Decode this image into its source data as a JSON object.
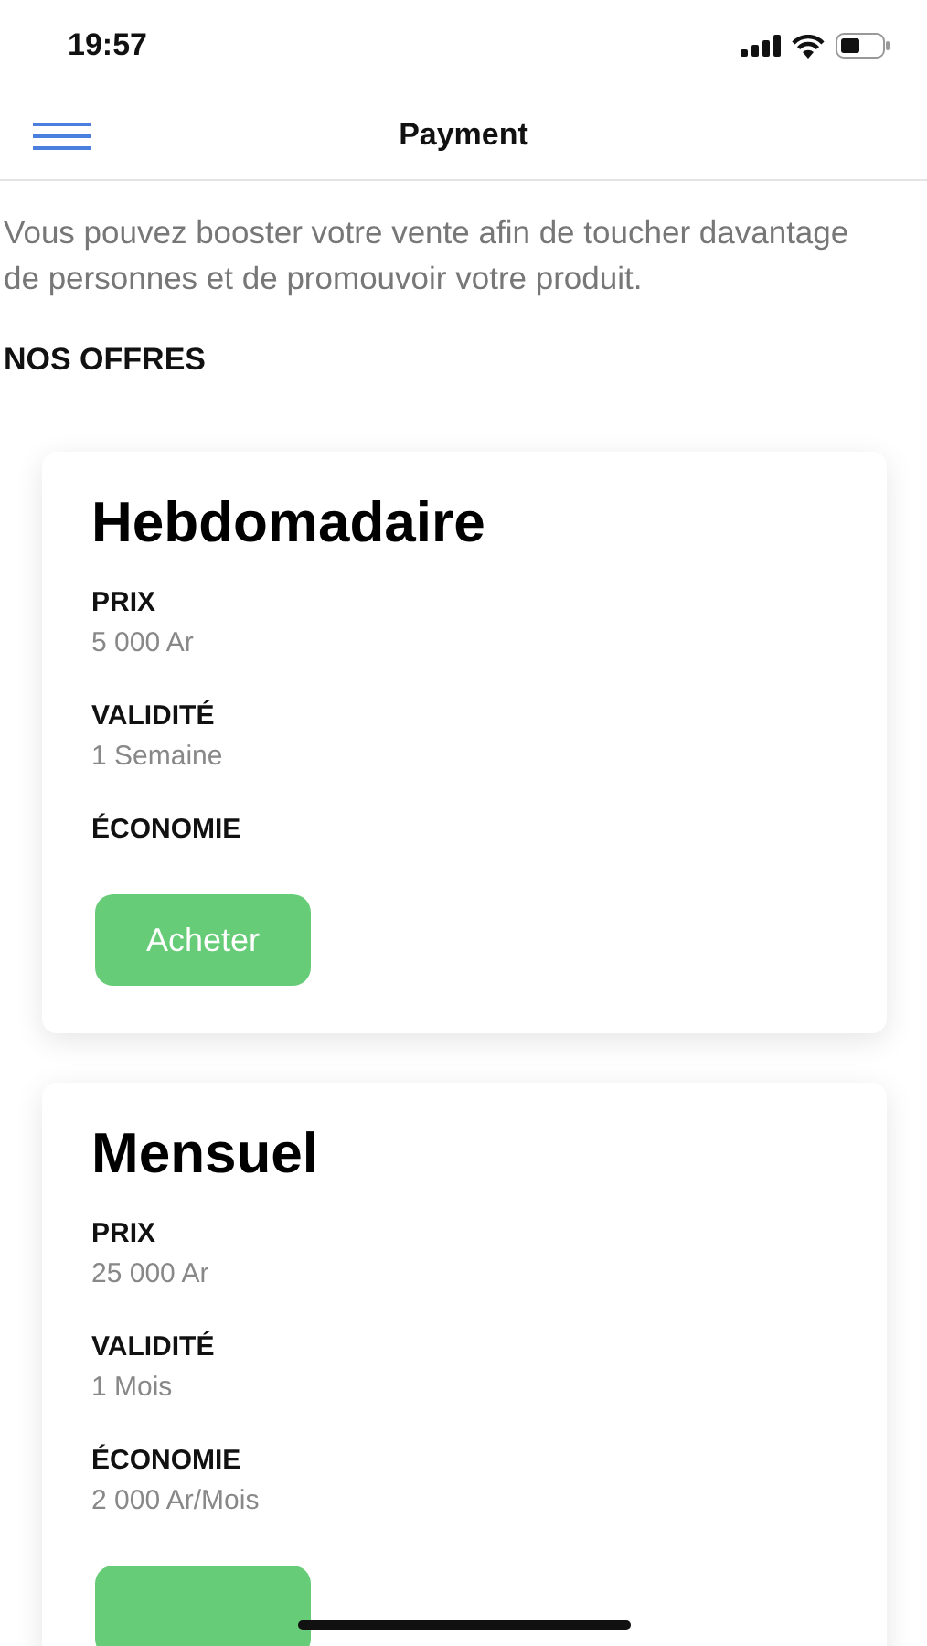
{
  "status_bar": {
    "time": "19:57"
  },
  "nav_bar": {
    "title": "Payment"
  },
  "intro": "Vous pouvez booster votre vente afin de toucher davantage de personnes et de promouvoir votre produit.",
  "section_title": "NOS OFFRES",
  "offers": [
    {
      "name": "Hebdomadaire",
      "fields": [
        {
          "label": "PRIX",
          "value": "5 000 Ar"
        },
        {
          "label": "VALIDITÉ",
          "value": "1 Semaine"
        },
        {
          "label": "ÉCONOMIE"
        }
      ],
      "button": "Acheter"
    },
    {
      "name": "Mensuel",
      "fields": [
        {
          "label": "PRIX",
          "value": "25 000 Ar"
        },
        {
          "label": "VALIDITÉ",
          "value": "1 Mois"
        },
        {
          "label": "ÉCONOMIE",
          "value": "2 000 Ar/Mois"
        }
      ],
      "button_partial": true
    }
  ]
}
